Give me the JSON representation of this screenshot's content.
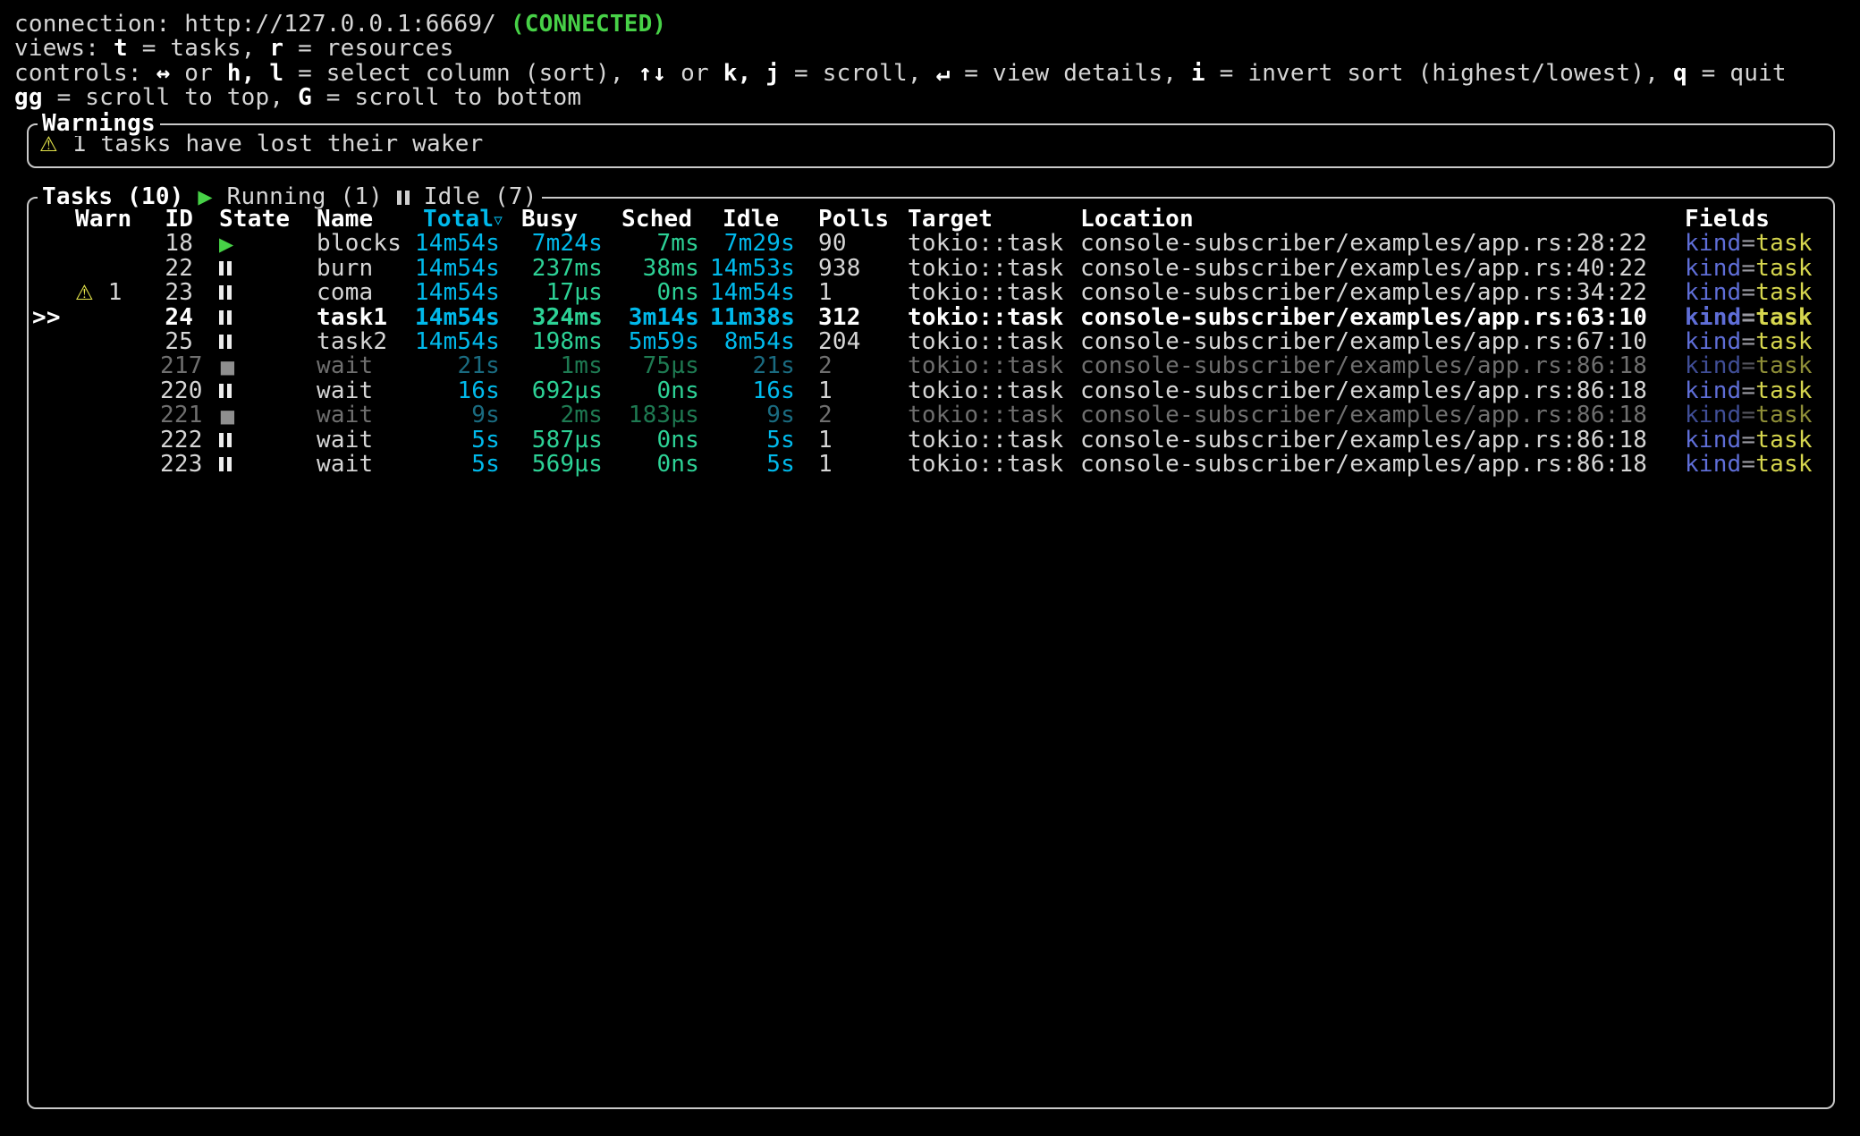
{
  "colors": {
    "fg": "#d6d6d6",
    "bright": "#ffffff",
    "dimfg": "#6f6f6f",
    "border": "#c9c9c9",
    "green": "#47d147",
    "cyan": "#00b9eb",
    "gdur": "#2dd296",
    "kindblue": "#5f6ed7",
    "yellow": "#d6d64e",
    "warnyellow": "#e3e34a"
  },
  "status_lines": {
    "connection": [
      {
        "t": "connection: "
      },
      {
        "t": "http://127.0.0.1:6669/ "
      },
      {
        "t": "(CONNECTED)",
        "c": "green"
      }
    ],
    "views": [
      {
        "t": "views: "
      },
      {
        "t": "t",
        "b": true
      },
      {
        "t": " = tasks, "
      },
      {
        "t": "r",
        "b": true
      },
      {
        "t": " = resources"
      }
    ],
    "controls": [
      {
        "t": "controls: "
      },
      {
        "t": "↔",
        "b": true
      },
      {
        "t": " or "
      },
      {
        "t": "h, l",
        "b": true
      },
      {
        "t": " = select column (sort), "
      },
      {
        "t": "↑↓",
        "b": true
      },
      {
        "t": " or "
      },
      {
        "t": "k, j",
        "b": true
      },
      {
        "t": " = scroll, "
      },
      {
        "t": "↵",
        "b": true
      },
      {
        "t": " = view details, "
      },
      {
        "t": "i",
        "b": true
      },
      {
        "t": " = invert sort (highest/lowest), "
      },
      {
        "t": "q",
        "b": true
      },
      {
        "t": " = quit"
      }
    ],
    "controls2": [
      {
        "t": "gg",
        "b": true
      },
      {
        "t": " = scroll to top, "
      },
      {
        "t": "G",
        "b": true
      },
      {
        "t": " = scroll to bottom"
      }
    ]
  },
  "warnings": {
    "title": "Warnings",
    "items": [
      {
        "icon": "warning-triangle-icon",
        "text": "1 tasks have lost their waker"
      }
    ]
  },
  "tasks": {
    "title": "Tasks (10)",
    "running_icon": "play-icon",
    "running_label": "Running (1)",
    "idle_icon": "pause-icon",
    "idle_label": "Idle (7)",
    "selection_marker": ">>",
    "sort_indicator": "▿",
    "sort_column": "Total",
    "columns": {
      "warn": "Warn",
      "id": "ID",
      "state": "State",
      "name": "Name",
      "total": "Total",
      "busy": "Busy",
      "sched": "Sched",
      "idle": "Idle",
      "polls": "Polls",
      "target": "Target",
      "location": "Location",
      "fields": "Fields"
    },
    "warn_icon": "warning-triangle-icon",
    "rows": [
      {
        "warn": "",
        "id": "18",
        "state": "running",
        "name": "blocks",
        "total": "14m54s",
        "busy": "7m24s",
        "sched": "7ms",
        "idle": "7m29s",
        "polls": "90",
        "target": "tokio::task",
        "location": "console-subscriber/examples/app.rs:28:22",
        "field_key": "kind",
        "field_eq": "=",
        "field_val": "task",
        "selected": false,
        "dim": false
      },
      {
        "warn": "",
        "id": "22",
        "state": "idle",
        "name": "burn",
        "total": "14m54s",
        "busy": "237ms",
        "sched": "38ms",
        "idle": "14m53s",
        "polls": "938",
        "target": "tokio::task",
        "location": "console-subscriber/examples/app.rs:40:22",
        "field_key": "kind",
        "field_eq": "=",
        "field_val": "task",
        "selected": false,
        "dim": false
      },
      {
        "warn": "1",
        "id": "23",
        "state": "idle",
        "name": "coma",
        "total": "14m54s",
        "busy": "17µs",
        "sched": "0ns",
        "idle": "14m54s",
        "polls": "1",
        "target": "tokio::task",
        "location": "console-subscriber/examples/app.rs:34:22",
        "field_key": "kind",
        "field_eq": "=",
        "field_val": "task",
        "selected": false,
        "dim": false
      },
      {
        "warn": "",
        "id": "24",
        "state": "idle",
        "name": "task1",
        "total": "14m54s",
        "busy": "324ms",
        "sched": "3m14s",
        "idle": "11m38s",
        "polls": "312",
        "target": "tokio::task",
        "location": "console-subscriber/examples/app.rs:63:10",
        "field_key": "kind",
        "field_eq": "=",
        "field_val": "task",
        "selected": true,
        "dim": false
      },
      {
        "warn": "",
        "id": "25",
        "state": "idle",
        "name": "task2",
        "total": "14m54s",
        "busy": "198ms",
        "sched": "5m59s",
        "idle": "8m54s",
        "polls": "204",
        "target": "tokio::task",
        "location": "console-subscriber/examples/app.rs:67:10",
        "field_key": "kind",
        "field_eq": "=",
        "field_val": "task",
        "selected": false,
        "dim": false
      },
      {
        "warn": "",
        "id": "217",
        "state": "completed",
        "name": "wait",
        "total": "21s",
        "busy": "1ms",
        "sched": "75µs",
        "idle": "21s",
        "polls": "2",
        "target": "tokio::task",
        "location": "console-subscriber/examples/app.rs:86:18",
        "field_key": "kind",
        "field_eq": "=",
        "field_val": "task",
        "selected": false,
        "dim": true
      },
      {
        "warn": "",
        "id": "220",
        "state": "idle",
        "name": "wait",
        "total": "16s",
        "busy": "692µs",
        "sched": "0ns",
        "idle": "16s",
        "polls": "1",
        "target": "tokio::task",
        "location": "console-subscriber/examples/app.rs:86:18",
        "field_key": "kind",
        "field_eq": "=",
        "field_val": "task",
        "selected": false,
        "dim": false
      },
      {
        "warn": "",
        "id": "221",
        "state": "completed",
        "name": "wait",
        "total": "9s",
        "busy": "2ms",
        "sched": "183µs",
        "idle": "9s",
        "polls": "2",
        "target": "tokio::task",
        "location": "console-subscriber/examples/app.rs:86:18",
        "field_key": "kind",
        "field_eq": "=",
        "field_val": "task",
        "selected": false,
        "dim": true
      },
      {
        "warn": "",
        "id": "222",
        "state": "idle",
        "name": "wait",
        "total": "5s",
        "busy": "587µs",
        "sched": "0ns",
        "idle": "5s",
        "polls": "1",
        "target": "tokio::task",
        "location": "console-subscriber/examples/app.rs:86:18",
        "field_key": "kind",
        "field_eq": "=",
        "field_val": "task",
        "selected": false,
        "dim": false
      },
      {
        "warn": "",
        "id": "223",
        "state": "idle",
        "name": "wait",
        "total": "5s",
        "busy": "569µs",
        "sched": "0ns",
        "idle": "5s",
        "polls": "1",
        "target": "tokio::task",
        "location": "console-subscriber/examples/app.rs:86:18",
        "field_key": "kind",
        "field_eq": "=",
        "field_val": "task",
        "selected": false,
        "dim": false
      }
    ]
  }
}
